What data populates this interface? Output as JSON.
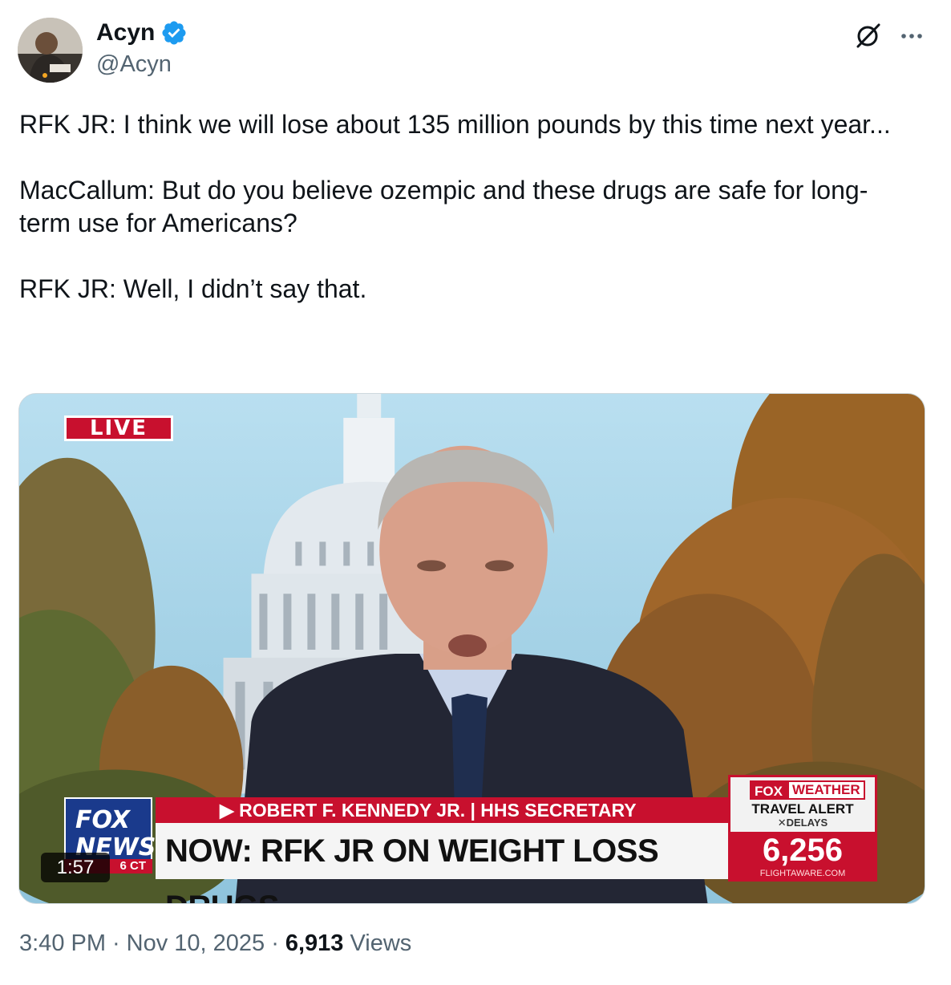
{
  "author": {
    "display_name": "Acyn",
    "handle": "@Acyn",
    "verified": true,
    "verified_color": "#1d9bf0"
  },
  "header_icons": {
    "grok": "grok-icon",
    "more": "more-icon"
  },
  "tweet": {
    "paragraphs": [
      "RFK JR: I think we will lose about 135 million pounds by this time next year...",
      "MacCallum: But do you believe ozempic and these drugs are safe for long-term use for Americans?",
      "RFK JR: Well, I didn’t say that."
    ]
  },
  "video": {
    "live_label": "LIVE",
    "network_logo_line1": "FOX",
    "network_logo_line2": "NEWS",
    "clock_label": "6 CT",
    "chyron_name": "▶ ROBERT F. KENNEDY JR. | HHS SECRETARY",
    "chyron_headline": "NOW: RFK JR ON WEIGHT LOSS DRUGS",
    "weather_brand_1": "FOX",
    "weather_brand_2": "WEATHER",
    "weather_alert": "TRAVEL ALERT",
    "weather_sub": "✕DELAYS",
    "weather_count": "6,256",
    "weather_source": "FLIGHTAWARE.COM",
    "duration": "1:57",
    "accent_red": "#c8102e",
    "fox_blue": "#1a3a8c"
  },
  "footer": {
    "time": "3:40 PM",
    "separator": "·",
    "date": "Nov 10, 2025",
    "views_count": "6,913",
    "views_label": "Views"
  }
}
